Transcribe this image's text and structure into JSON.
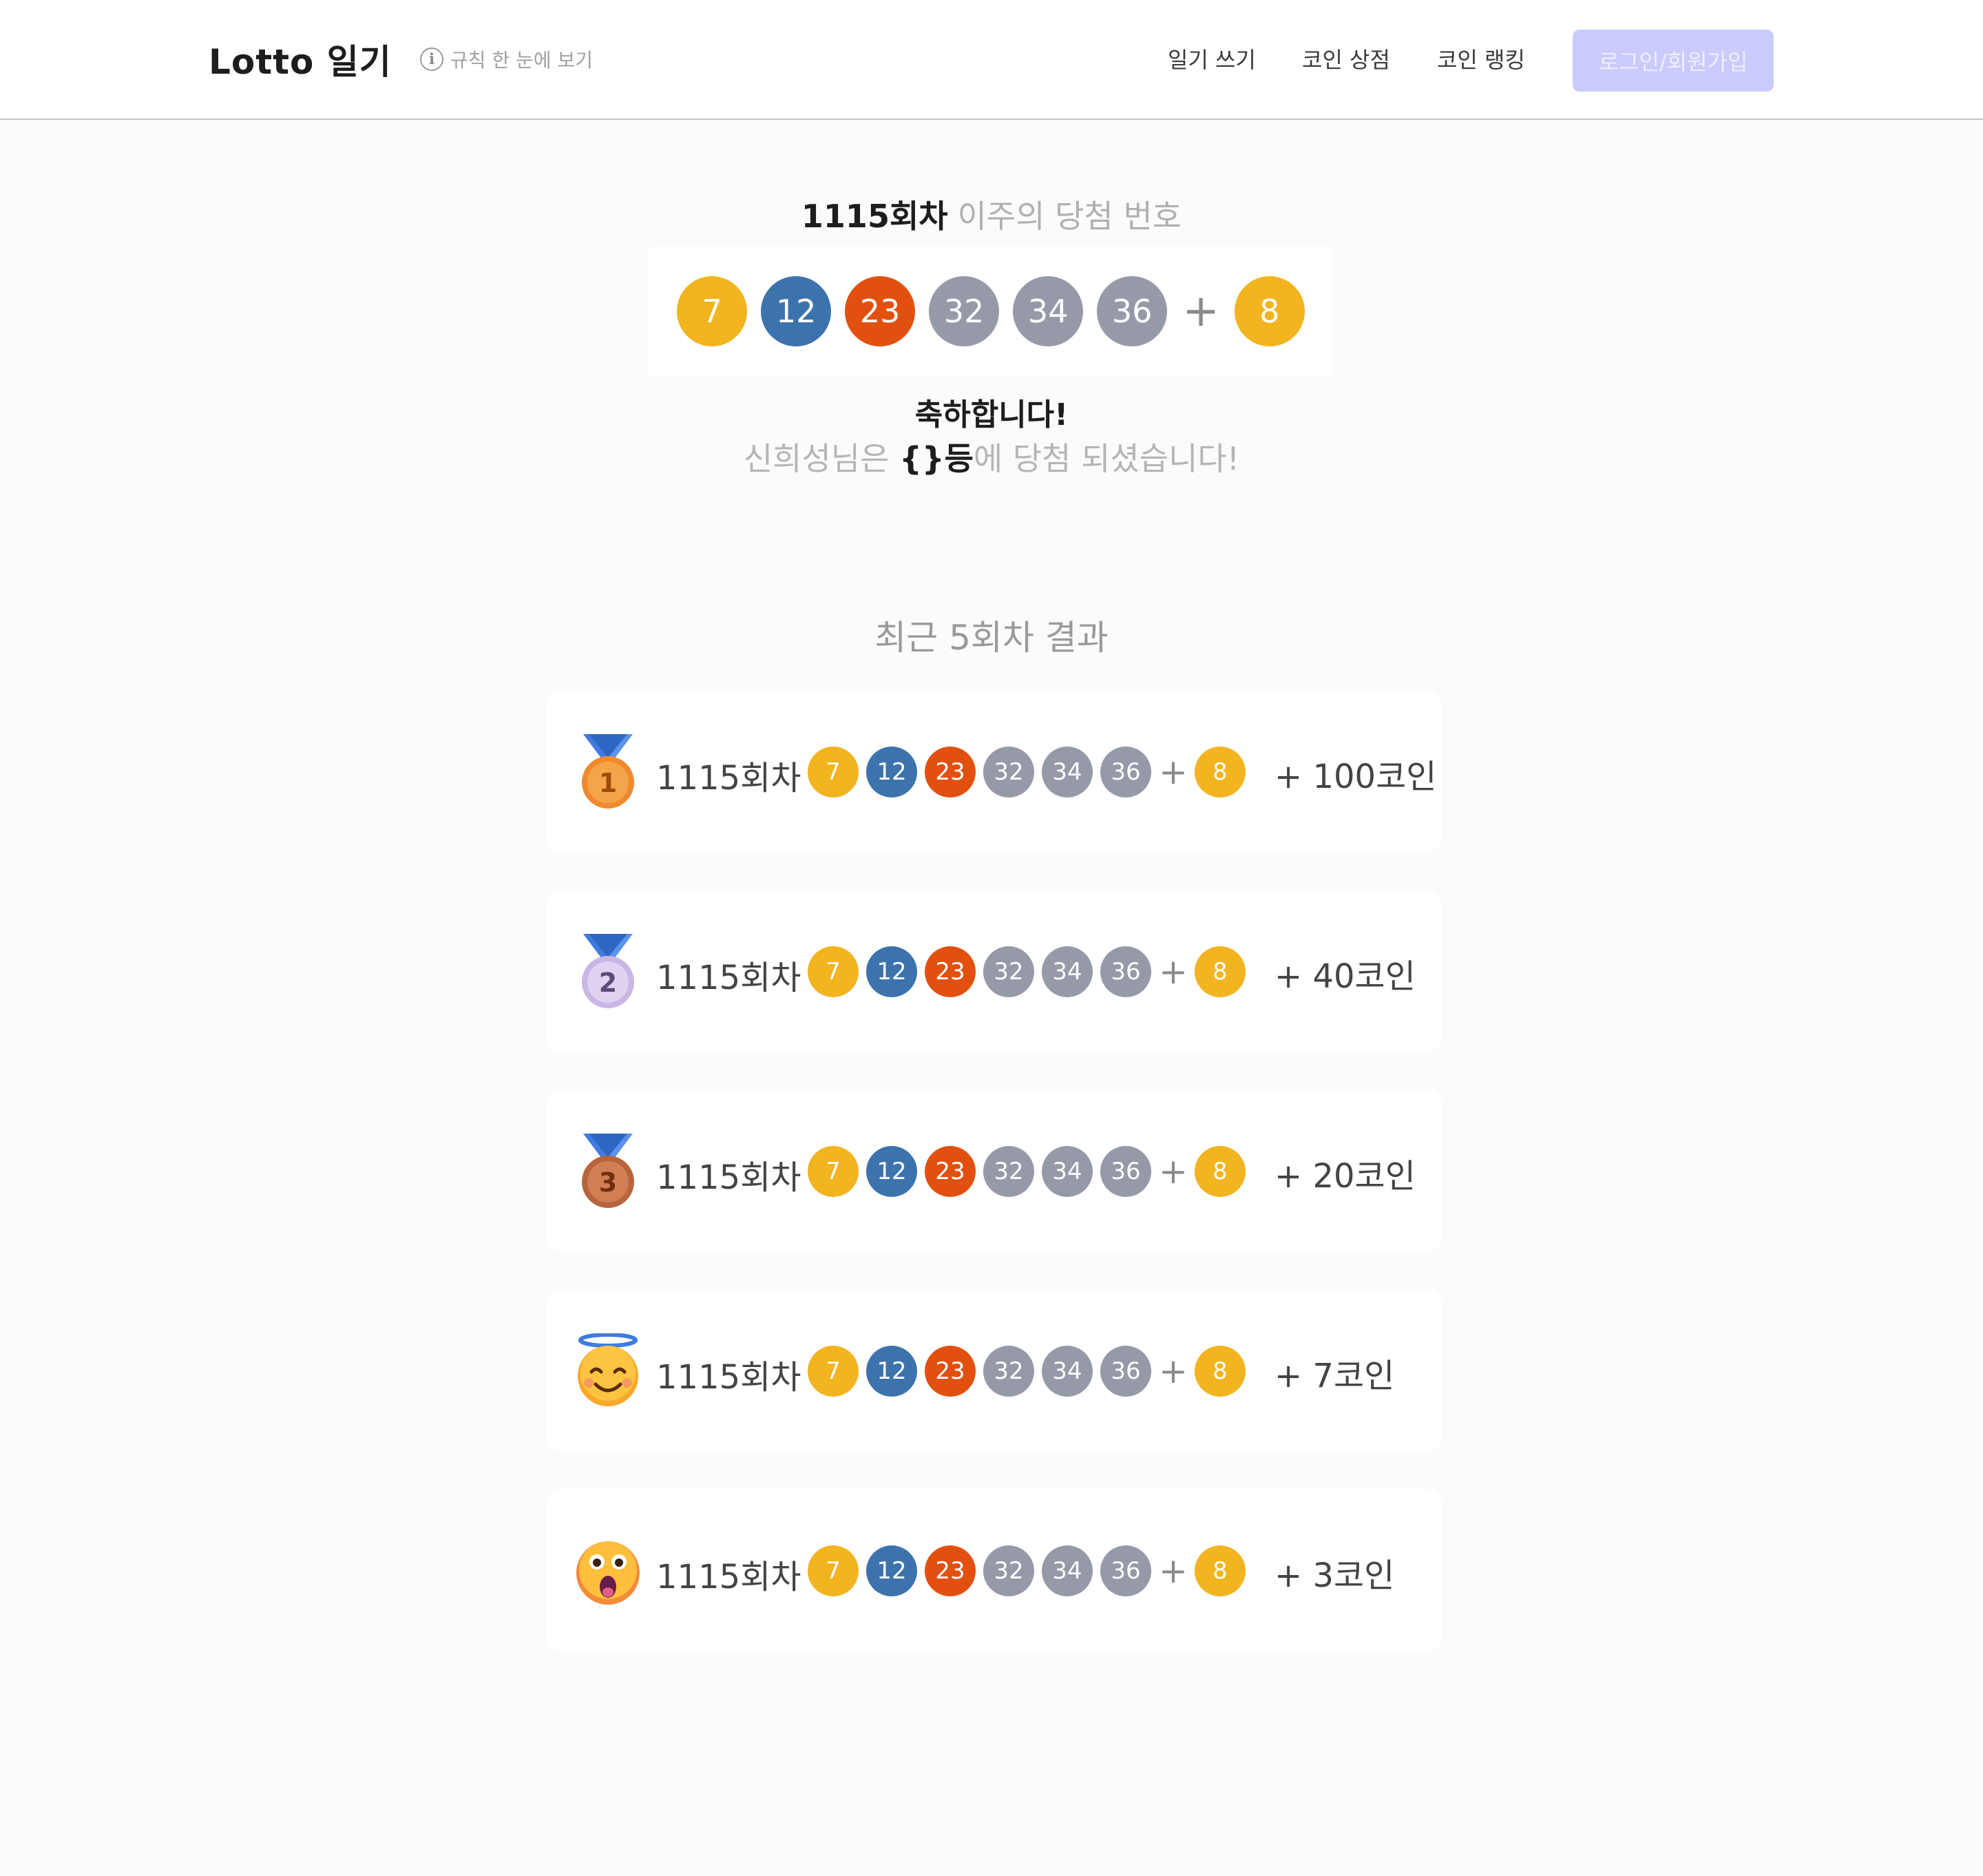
{
  "header": {
    "logo": "Lotto 일기",
    "rules_label": "규칙 한 눈에 보기",
    "nav": [
      "일기 쓰기",
      "코인 상점",
      "코인 랭킹"
    ],
    "login_label": "로그인/회원가입"
  },
  "colors": {
    "yellow": "#f2b41f",
    "blue": "#3d73ad",
    "orange": "#e2500f",
    "gray": "#9699a8",
    "accent": "#c8cbfb"
  },
  "this_week": {
    "round": "1115회차",
    "subtitle": "이주의 당첨 번호",
    "numbers": [
      {
        "n": "7",
        "color": "yellow"
      },
      {
        "n": "12",
        "color": "blue"
      },
      {
        "n": "23",
        "color": "orange"
      },
      {
        "n": "32",
        "color": "gray"
      },
      {
        "n": "34",
        "color": "gray"
      },
      {
        "n": "36",
        "color": "gray"
      }
    ],
    "plus": "+",
    "bonus": {
      "n": "8",
      "color": "yellow"
    },
    "congrats": "축하합니다!",
    "msg_prefix": "신희성님은 ",
    "msg_rank": "{}등",
    "msg_suffix": "에 당첨 되셨습니다!"
  },
  "recent": {
    "title": "최근 5회차 결과",
    "rows": [
      {
        "icon": "gold-medal-icon",
        "round": "1115회차",
        "coin": "+ 100코인"
      },
      {
        "icon": "silver-medal-icon",
        "round": "1115회차",
        "coin": "+ 40코인"
      },
      {
        "icon": "bronze-medal-icon",
        "round": "1115회차",
        "coin": "+ 20코인"
      },
      {
        "icon": "smiling-face-with-halo-icon",
        "round": "1115회차",
        "coin": "+ 7코인"
      },
      {
        "icon": "astonished-face-icon",
        "round": "1115회차",
        "coin": "+ 3코인"
      }
    ]
  }
}
